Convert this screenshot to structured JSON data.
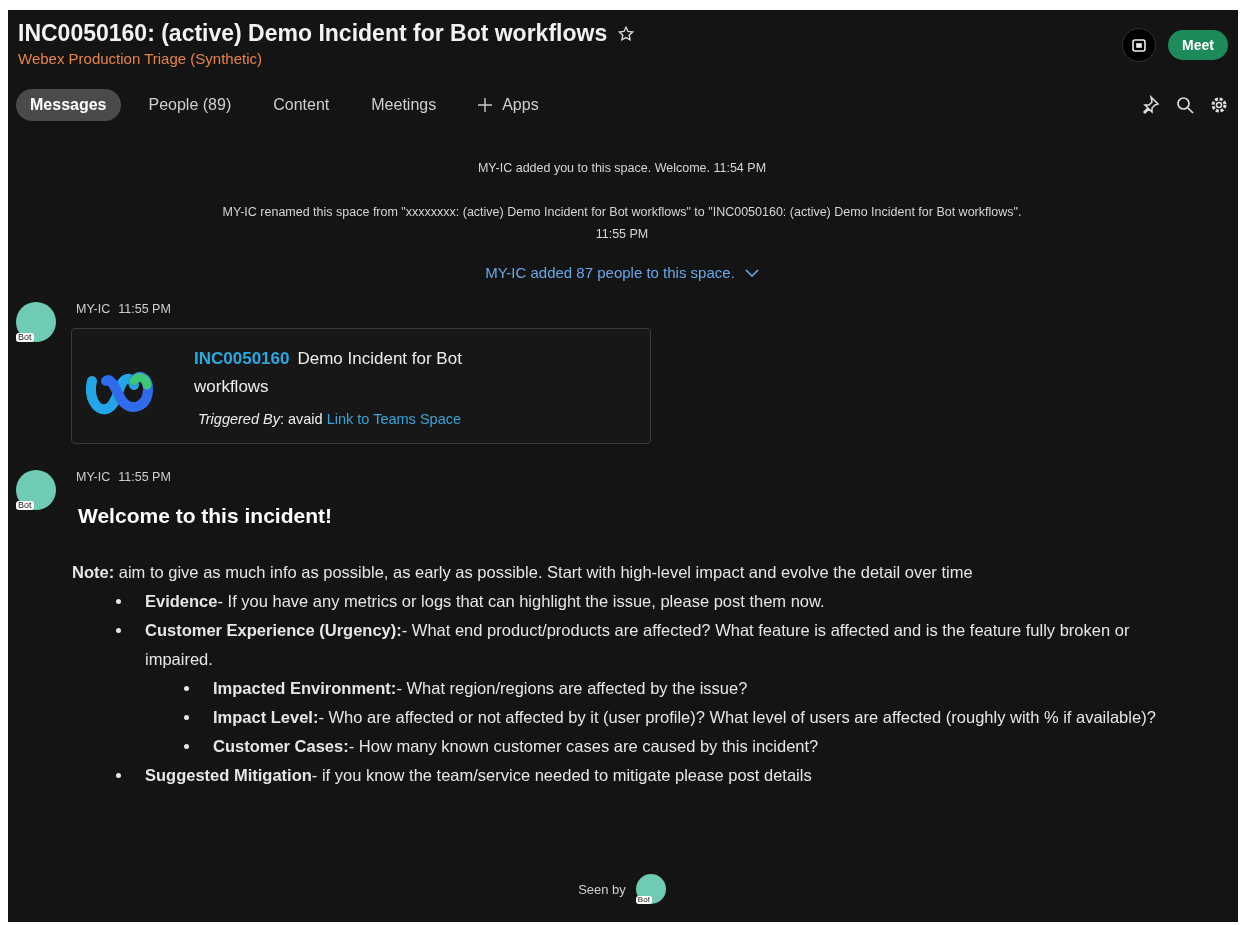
{
  "header": {
    "title": "INC0050160: (active) Demo Incident for Bot workflows",
    "subtitle": "Webex Production Triage (Synthetic)",
    "meet_button": "Meet"
  },
  "tabs": [
    {
      "label": "Messages",
      "selected": true,
      "kind": "tab"
    },
    {
      "label": "People (89)",
      "selected": false,
      "kind": "tab"
    },
    {
      "label": "Content",
      "selected": false,
      "kind": "tab"
    },
    {
      "label": "Meetings",
      "selected": false,
      "kind": "tab"
    },
    {
      "label": "Apps",
      "selected": false,
      "kind": "add"
    }
  ],
  "system_messages": [
    {
      "text": "MY-IC added you to this space. Welcome. 11:54 PM",
      "kind": "plain"
    },
    {
      "text": "MY-IC renamed this space from \"xxxxxxxx: (active) Demo Incident for Bot workflows\" to \"INC0050160: (active) Demo Incident for Bot workflows\".\n11:55 PM",
      "kind": "plain"
    },
    {
      "text": "MY-IC added 87 people to this space.",
      "kind": "expandable"
    }
  ],
  "messages": [
    {
      "sender": "MY-IC",
      "time": "11:55 PM",
      "avatar_badge": "Bot",
      "kind": "card",
      "card": {
        "incident_id": "INC0050160",
        "title": "Demo Incident for Bot workflows",
        "triggered_label": "Triggered By",
        "triggered_value": ": avaid",
        "link": "Link to Teams Space"
      }
    },
    {
      "sender": "MY-IC",
      "time": "11:55 PM",
      "avatar_badge": "Bot",
      "kind": "text",
      "heading": "Welcome to this incident!",
      "note": "**Note:** aim to give as much info as possible, as early as possible. Start with high-level impact and evolve the detail over time",
      "items": [
        {
          "text": "**Evidence**- If you have any metrics or logs that can highlight the issue, please post them now."
        },
        {
          "text": "**Customer Experience (Urgency):**- What end product/products are affected? What feature is affected and is the feature fully broken or impaired.",
          "children": [
            {
              "text": "**Impacted Environment:**- What region/regions are affected by the issue?"
            },
            {
              "text": "**Impact Level:**-  Who are affected or not affected by it (user profile)? What level of users are affected (roughly with % if available)?"
            },
            {
              "text": "**Customer Cases:**-  How many known customer cases are caused by this incident?"
            }
          ]
        },
        {
          "text": "**Suggested Mitigation**-  if you know the team/service needed to mitigate please post details"
        }
      ]
    }
  ],
  "seen_by": {
    "label": "Seen by",
    "avatar_badge": "Bot"
  }
}
